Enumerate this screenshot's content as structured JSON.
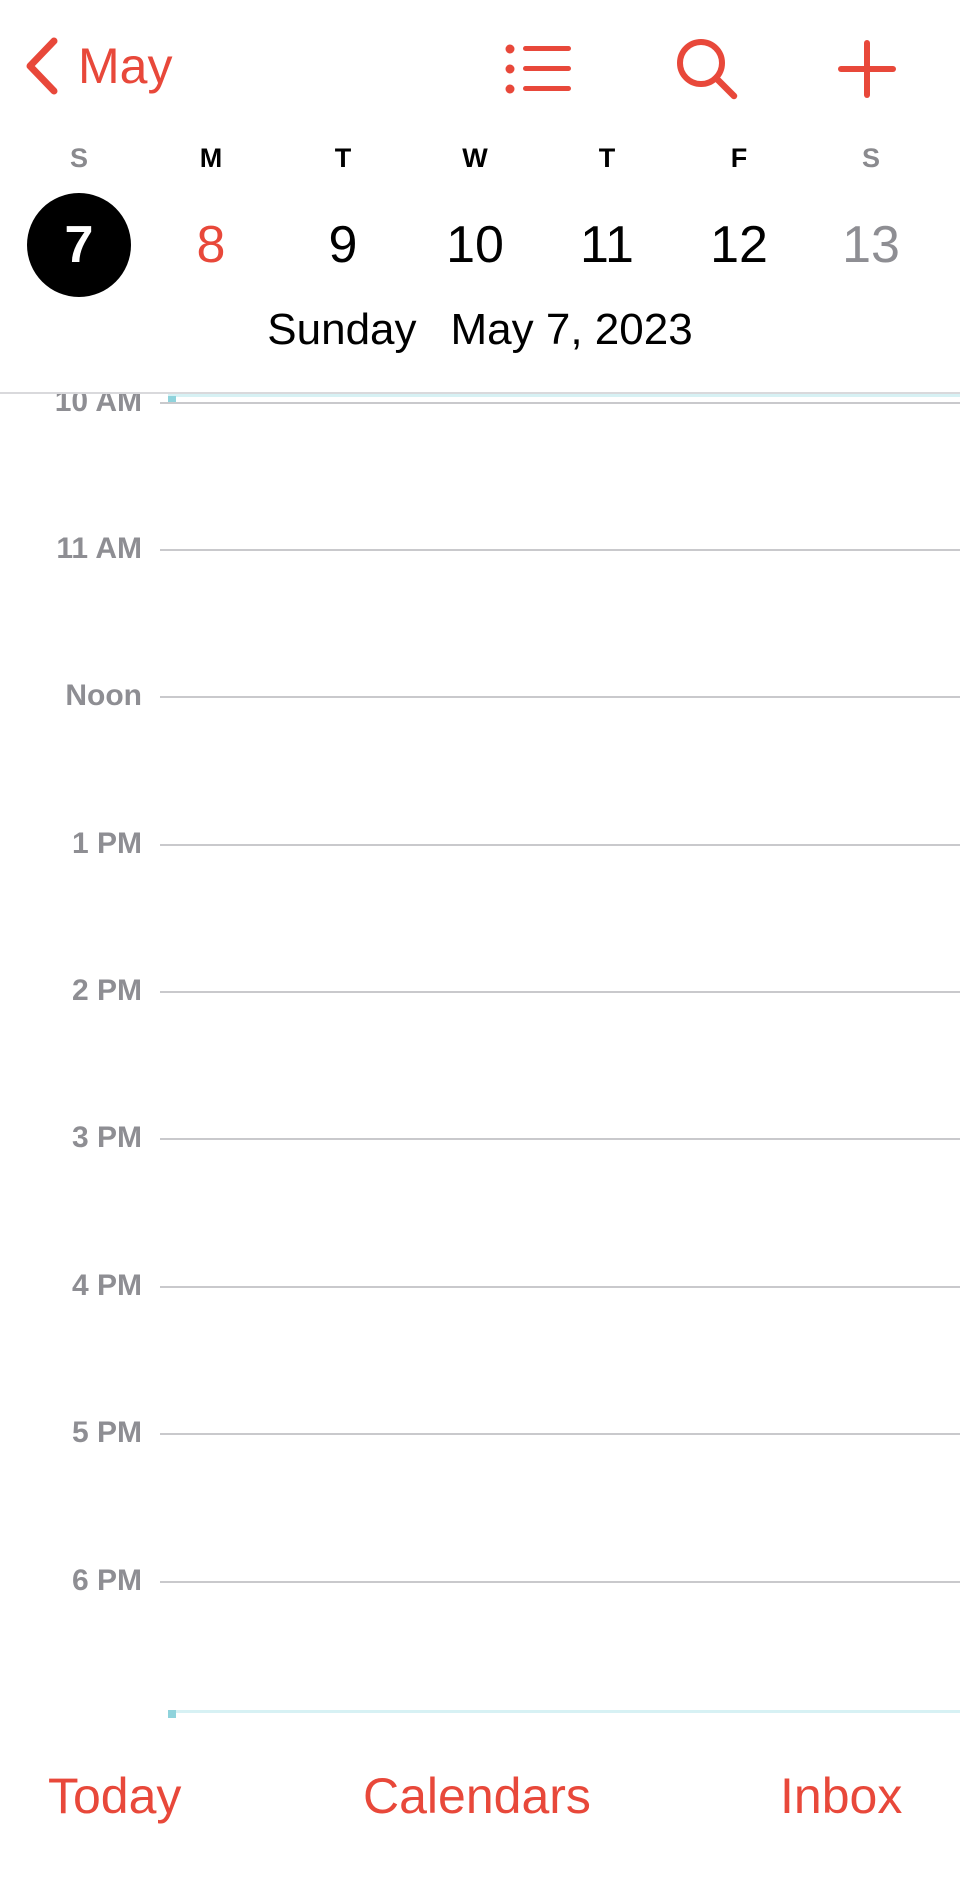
{
  "colors": {
    "accent": "#E8483A",
    "secondary_text": "#8E8E93",
    "selected_circle": "#000000",
    "allday_strip": "#D7F1F4"
  },
  "nav": {
    "back_label": "May",
    "icons": [
      "chevron-left-icon",
      "list-icon",
      "search-icon",
      "plus-icon"
    ]
  },
  "week": {
    "weekdays": [
      "S",
      "M",
      "T",
      "W",
      "T",
      "F",
      "S"
    ],
    "dates": [
      "7",
      "8",
      "9",
      "10",
      "11",
      "12",
      "13"
    ],
    "selected_index": 0,
    "today_index": 1
  },
  "date_title": {
    "weekday": "Sunday",
    "date": "May 7, 2023"
  },
  "timeline": {
    "hours": [
      "10 AM",
      "11 AM",
      "Noon",
      "1 PM",
      "2 PM",
      "3 PM",
      "4 PM",
      "5 PM",
      "6 PM"
    ]
  },
  "toolbar": {
    "today": "Today",
    "calendars": "Calendars",
    "inbox": "Inbox"
  }
}
